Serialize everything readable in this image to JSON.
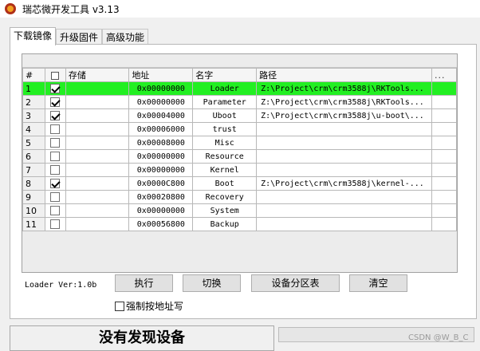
{
  "window": {
    "title": "瑞芯微开发工具 v3.13",
    "icon": "rockchip-logo-icon"
  },
  "tabs": [
    {
      "label": "下载镜像",
      "active": true
    },
    {
      "label": "升级固件",
      "active": false
    },
    {
      "label": "高级功能",
      "active": false
    }
  ],
  "table": {
    "headers": {
      "num": "#",
      "check": "☐",
      "storage": "存储",
      "address": "地址",
      "name": "名字",
      "path": "路径",
      "more": "..."
    },
    "rows": [
      {
        "num": "1",
        "checked": true,
        "storage": "",
        "address": "0x00000000",
        "name": "Loader",
        "path": "Z:\\Project\\crm\\crm3588j\\RKTools...",
        "selected": true
      },
      {
        "num": "2",
        "checked": true,
        "storage": "",
        "address": "0x00000000",
        "name": "Parameter",
        "path": "Z:\\Project\\crm\\crm3588j\\RKTools...",
        "selected": false
      },
      {
        "num": "3",
        "checked": true,
        "storage": "",
        "address": "0x00004000",
        "name": "Uboot",
        "path": "Z:\\Project\\crm\\crm3588j\\u-boot\\...",
        "selected": false
      },
      {
        "num": "4",
        "checked": false,
        "storage": "",
        "address": "0x00006000",
        "name": "trust",
        "path": "",
        "selected": false
      },
      {
        "num": "5",
        "checked": false,
        "storage": "",
        "address": "0x00008000",
        "name": "Misc",
        "path": "",
        "selected": false
      },
      {
        "num": "6",
        "checked": false,
        "storage": "",
        "address": "0x00000000",
        "name": "Resource",
        "path": "",
        "selected": false
      },
      {
        "num": "7",
        "checked": false,
        "storage": "",
        "address": "0x00000000",
        "name": "Kernel",
        "path": "",
        "selected": false
      },
      {
        "num": "8",
        "checked": true,
        "storage": "",
        "address": "0x0000C800",
        "name": "Boot",
        "path": "Z:\\Project\\crm\\crm3588j\\kernel-...",
        "selected": false
      },
      {
        "num": "9",
        "checked": false,
        "storage": "",
        "address": "0x00020800",
        "name": "Recovery",
        "path": "",
        "selected": false
      },
      {
        "num": "10",
        "checked": false,
        "storage": "",
        "address": "0x00000000",
        "name": "System",
        "path": "",
        "selected": false
      },
      {
        "num": "11",
        "checked": false,
        "storage": "",
        "address": "0x00056800",
        "name": "Backup",
        "path": "",
        "selected": false
      }
    ]
  },
  "loader_version": "Loader Ver:1.0b",
  "buttons": {
    "execute": "执行",
    "switch": "切换",
    "partition": "设备分区表",
    "clear": "清空"
  },
  "force_address": {
    "label": "强制按地址写",
    "checked": false
  },
  "status": {
    "message": "没有发现设备"
  },
  "watermark": "CSDN @W_B_C",
  "colors": {
    "selected_row": "#22ef22",
    "window_bg": "#f0f0f0"
  }
}
